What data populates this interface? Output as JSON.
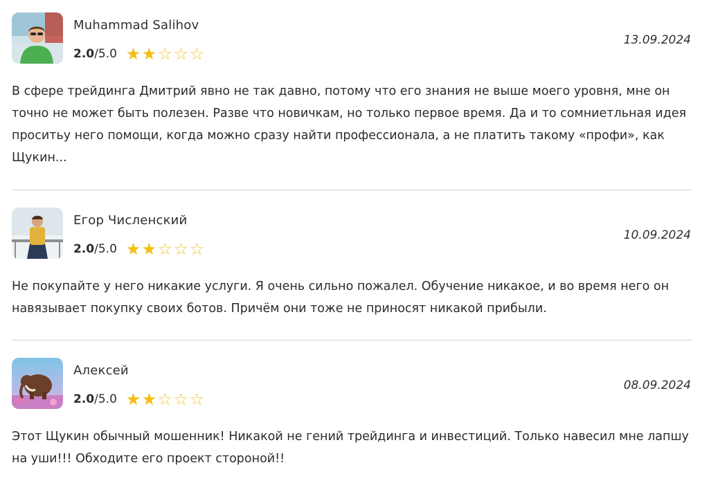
{
  "reviews": [
    {
      "author": "Muhammad Salihov",
      "score": "2.0",
      "max": "/5.0",
      "stars_filled": 2,
      "stars_total": 5,
      "date": "13.09.2024",
      "text": "В сфере трейдинга Дмитрий явно не так давно, потому что его знания не выше моего уровня, мне он точно не может быть полезен. Разве что новичкам, но только первое время. Да и то сомниетльная идея проситьу него помощи, когда можно сразу найти профессионала, а не платить такому «профи», как Щукин..."
    },
    {
      "author": "Егор Численский",
      "score": "2.0",
      "max": "/5.0",
      "stars_filled": 2,
      "stars_total": 5,
      "date": "10.09.2024",
      "text": "Не покупайте у него никакие услуги. Я очень сильно пожалел. Обучение никакое, и во время него он навязывает покупку своих ботов. Причём они тоже не приносят никакой прибыли."
    },
    {
      "author": "Алексей",
      "score": "2.0",
      "max": "/5.0",
      "stars_filled": 2,
      "stars_total": 5,
      "date": "08.09.2024",
      "text": "Этот Щукин обычный мошенник! Никакой не гений трейдинга и инвестиций. Только навесил мне лапшу на уши!!! Обходите его проект стороной!!"
    }
  ],
  "colors": {
    "star": "#f4bd12",
    "divider": "#cfcfcf"
  },
  "icons": {
    "star_full": "★",
    "star_empty": "☆"
  }
}
